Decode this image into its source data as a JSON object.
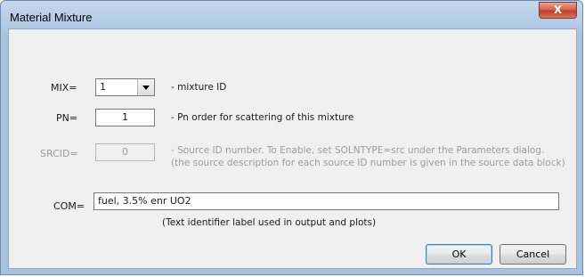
{
  "window": {
    "title": "Material Mixture",
    "close_glyph": "X"
  },
  "mix": {
    "label": "MIX=",
    "value": "1",
    "description": "- mixture ID"
  },
  "pn": {
    "label": "PN=",
    "value": "1",
    "description": "- Pn order for scattering of this mixture"
  },
  "srcid": {
    "label": "SRCID=",
    "value": "0",
    "description_line1": "- Source ID number. To Enable, set SOLNTYPE=src under the Parameters dialog.",
    "description_line2": "(the source description for each source ID number is given in the source data block)"
  },
  "com": {
    "label": "COM=",
    "value": "fuel, 3.5% enr UO2",
    "description": "(Text identifier label used in output and plots)"
  },
  "buttons": {
    "ok": "OK",
    "cancel": "Cancel"
  },
  "icons": {
    "close": "close-icon",
    "dropdown": "chevron-down-icon"
  }
}
